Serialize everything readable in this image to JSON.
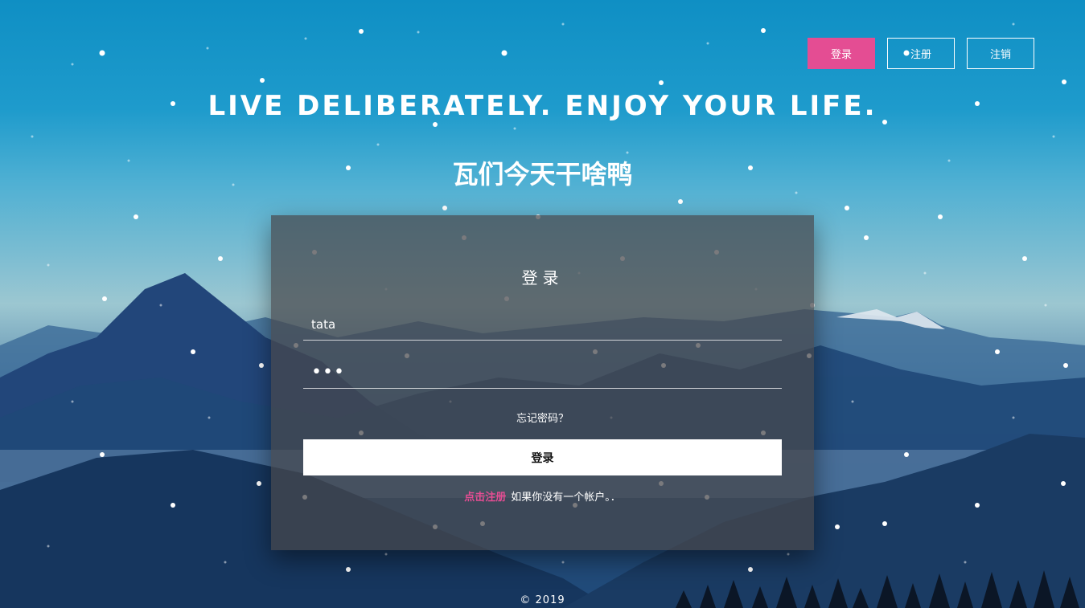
{
  "nav": {
    "login_label": "登录",
    "register_label": "注册",
    "logout_label": "注销"
  },
  "hero": {
    "headline": "LIVE DELIBERATELY. ENJOY YOUR LIFE.",
    "subline": "瓦们今天干啥鸭"
  },
  "login_form": {
    "title": "登录",
    "username_value": "tata",
    "password_value": "•••",
    "forgot_label": "忘记密码？",
    "submit_label": "登录",
    "register_link_label": "点击注册",
    "register_hint": "如果你没有一个帐户。．"
  },
  "footer": {
    "copyright": "© 2019"
  },
  "colors": {
    "accent": "#e44d93",
    "sky_top": "#0f8fc4",
    "panel": "#46464b"
  }
}
